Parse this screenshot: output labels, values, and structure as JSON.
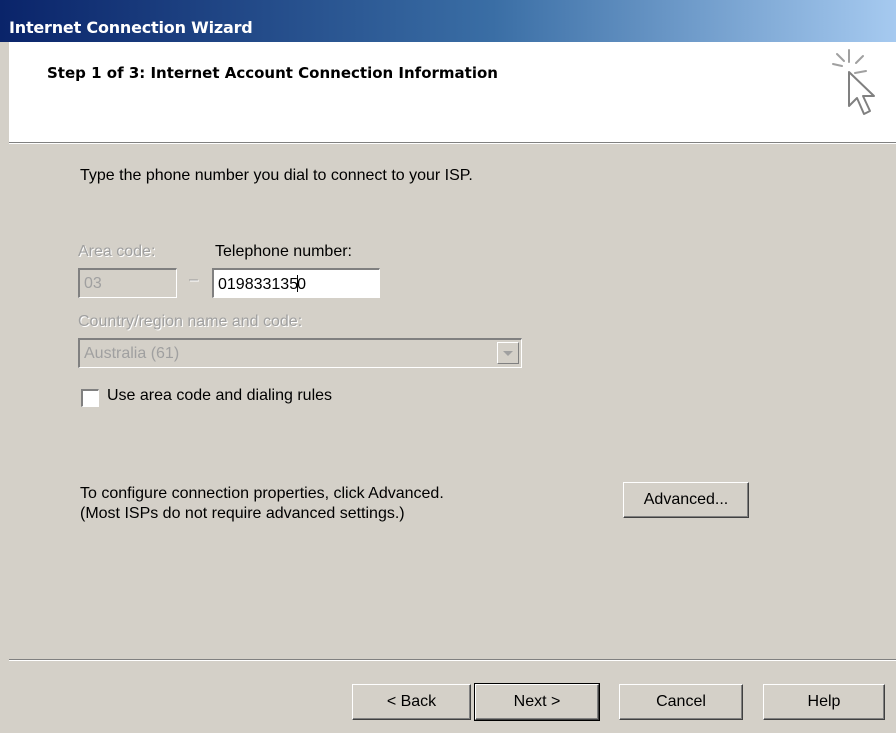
{
  "window": {
    "title": "Internet Connection Wizard"
  },
  "header": {
    "step_title": "Step 1 of 3: Internet Account Connection Information",
    "icon": "wizard-cursor-icon"
  },
  "body": {
    "instruction": "Type the phone number you dial to connect to your ISP.",
    "area_code": {
      "label": "Area code:",
      "value": "03",
      "enabled": false
    },
    "separator": "–",
    "telephone": {
      "label": "Telephone number:",
      "value_before_caret": "019833135",
      "value_after_caret": "0"
    },
    "country": {
      "label": "Country/region name and code:",
      "selected": "Australia (61)",
      "enabled": false
    },
    "use_area_code": {
      "label": "Use area code and dialing rules",
      "checked": false
    },
    "advanced_text_1": "To configure connection properties, click Advanced.",
    "advanced_text_2": "(Most ISPs do not require advanced settings.)",
    "advanced_button": "Advanced..."
  },
  "footer": {
    "back": "< Back",
    "next": "Next >",
    "cancel": "Cancel",
    "help": "Help"
  }
}
